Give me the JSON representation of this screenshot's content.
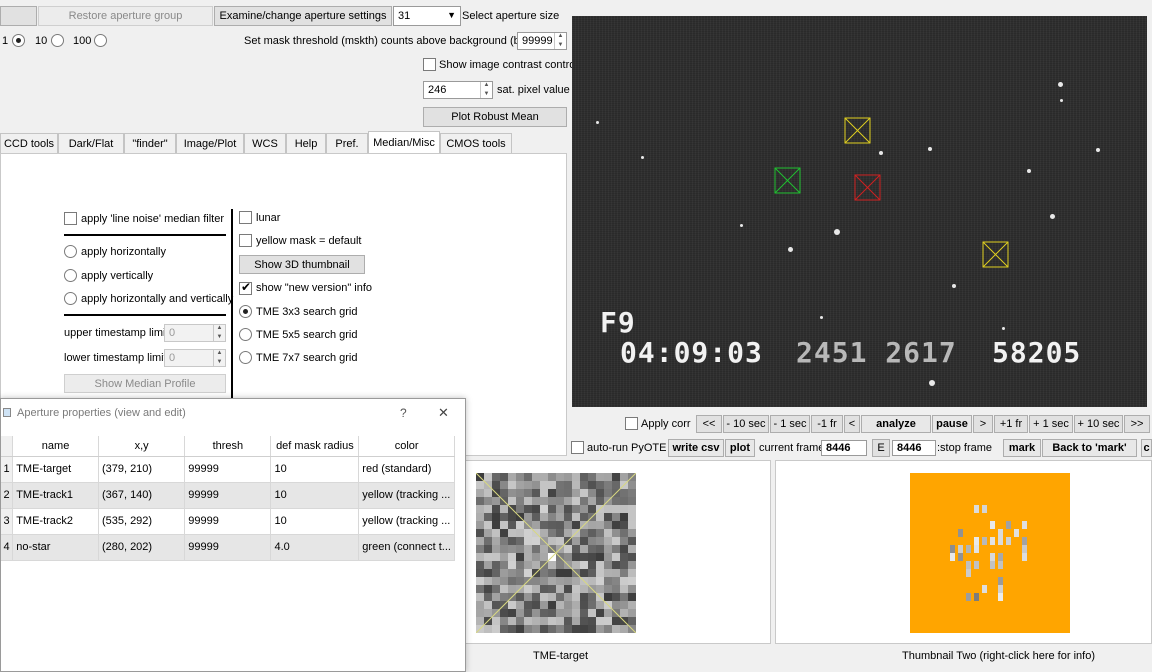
{
  "top": {
    "restore_label": "Restore aperture group",
    "examine_label": "Examine/change aperture settings",
    "aperture_size": "31",
    "select_aperture_label": "Select aperture size",
    "radio_1": "1",
    "radio_10": "10",
    "radio_100": "100",
    "mask_threshold_label": "Set mask threshold (mskth) counts above background (bkavg)",
    "mask_threshold_value": "99999",
    "show_contrast_label": "Show image contrast control",
    "sat_value": "246",
    "sat_label": "sat. pixel value",
    "robust_mean_label": "Plot Robust Mean"
  },
  "tabs": [
    "CCD tools",
    "Dark/Flat",
    "\"finder\"",
    "Image/Plot",
    "WCS",
    "Help",
    "Pref.",
    "Median/Misc",
    "CMOS tools"
  ],
  "misc": {
    "line_noise_label": "apply 'line noise' median filter",
    "horiz_label": "apply horizontally",
    "vert_label": "apply vertically",
    "both_label": "apply horizontally and vertically",
    "upper_ts_label": "upper timestamp limit",
    "upper_ts_value": "0",
    "lower_ts_label": "lower timestamp limit",
    "lower_ts_value": "0",
    "median_profile_label": "Show Median Profile",
    "lunar_label": "lunar",
    "yellow_mask_label": "yellow mask = default",
    "show_3d_label": "Show 3D thumbnail",
    "new_version_label": "show \"new version\" info",
    "grid3_label": "TME 3x3 search grid",
    "grid5_label": "TME 5x5 search grid",
    "grid7_label": "TME 7x7 search grid"
  },
  "aperture_window": {
    "title": "Aperture properties (view and edit)",
    "help": "?",
    "close": "✕",
    "columns": [
      "name",
      "x,y",
      "thresh",
      "def mask radius",
      "color"
    ],
    "rows": [
      {
        "num": "1",
        "name": "TME-target",
        "xy": "(379, 210)",
        "thresh": "99999",
        "radius": "10",
        "color": "red (standard)"
      },
      {
        "num": "2",
        "name": "TME-track1",
        "xy": "(367, 140)",
        "thresh": "99999",
        "radius": "10",
        "color": "yellow (tracking ..."
      },
      {
        "num": "3",
        "name": "TME-track2",
        "xy": "(535, 292)",
        "thresh": "99999",
        "radius": "10",
        "color": "yellow (tracking ..."
      },
      {
        "num": "4",
        "name": "no-star",
        "xy": "(280, 202)",
        "thresh": "99999",
        "radius": "4.0",
        "color": "green (connect t..."
      }
    ]
  },
  "video": {
    "osd_line1": "F9",
    "osd_line2a": "04:09:03",
    "osd_line2b": "2451 2617",
    "osd_line2c": "58205"
  },
  "controls": {
    "apply_corr": "Apply corr",
    "btn_back2": "<<",
    "btn_m10": "- 10 sec",
    "btn_m1": "- 1 sec",
    "btn_m1fr": "-1 fr",
    "btn_back1": "<",
    "analyze": "analyze",
    "pause": "pause",
    "btn_fwd1": ">",
    "btn_p1fr": "+1 fr",
    "btn_p1": "+ 1 sec",
    "btn_p10": "+ 10 sec",
    "btn_fwd2": ">>",
    "auto_run": "auto-run PyOTE",
    "write_csv": "write csv",
    "plot": "plot",
    "current_frame_label": "current frame:",
    "current_frame": "8446",
    "e_label": "E",
    "stop_frame": "8446",
    "stop_frame_label": ":stop frame",
    "mark": "mark",
    "back_to_mark": "Back to 'mark'",
    "cut_label": "c"
  },
  "thumbs": {
    "one_caption": "TME-target",
    "two_caption": "Thumbnail Two (right-click here for info)",
    "two_bg": "#ffa500"
  }
}
